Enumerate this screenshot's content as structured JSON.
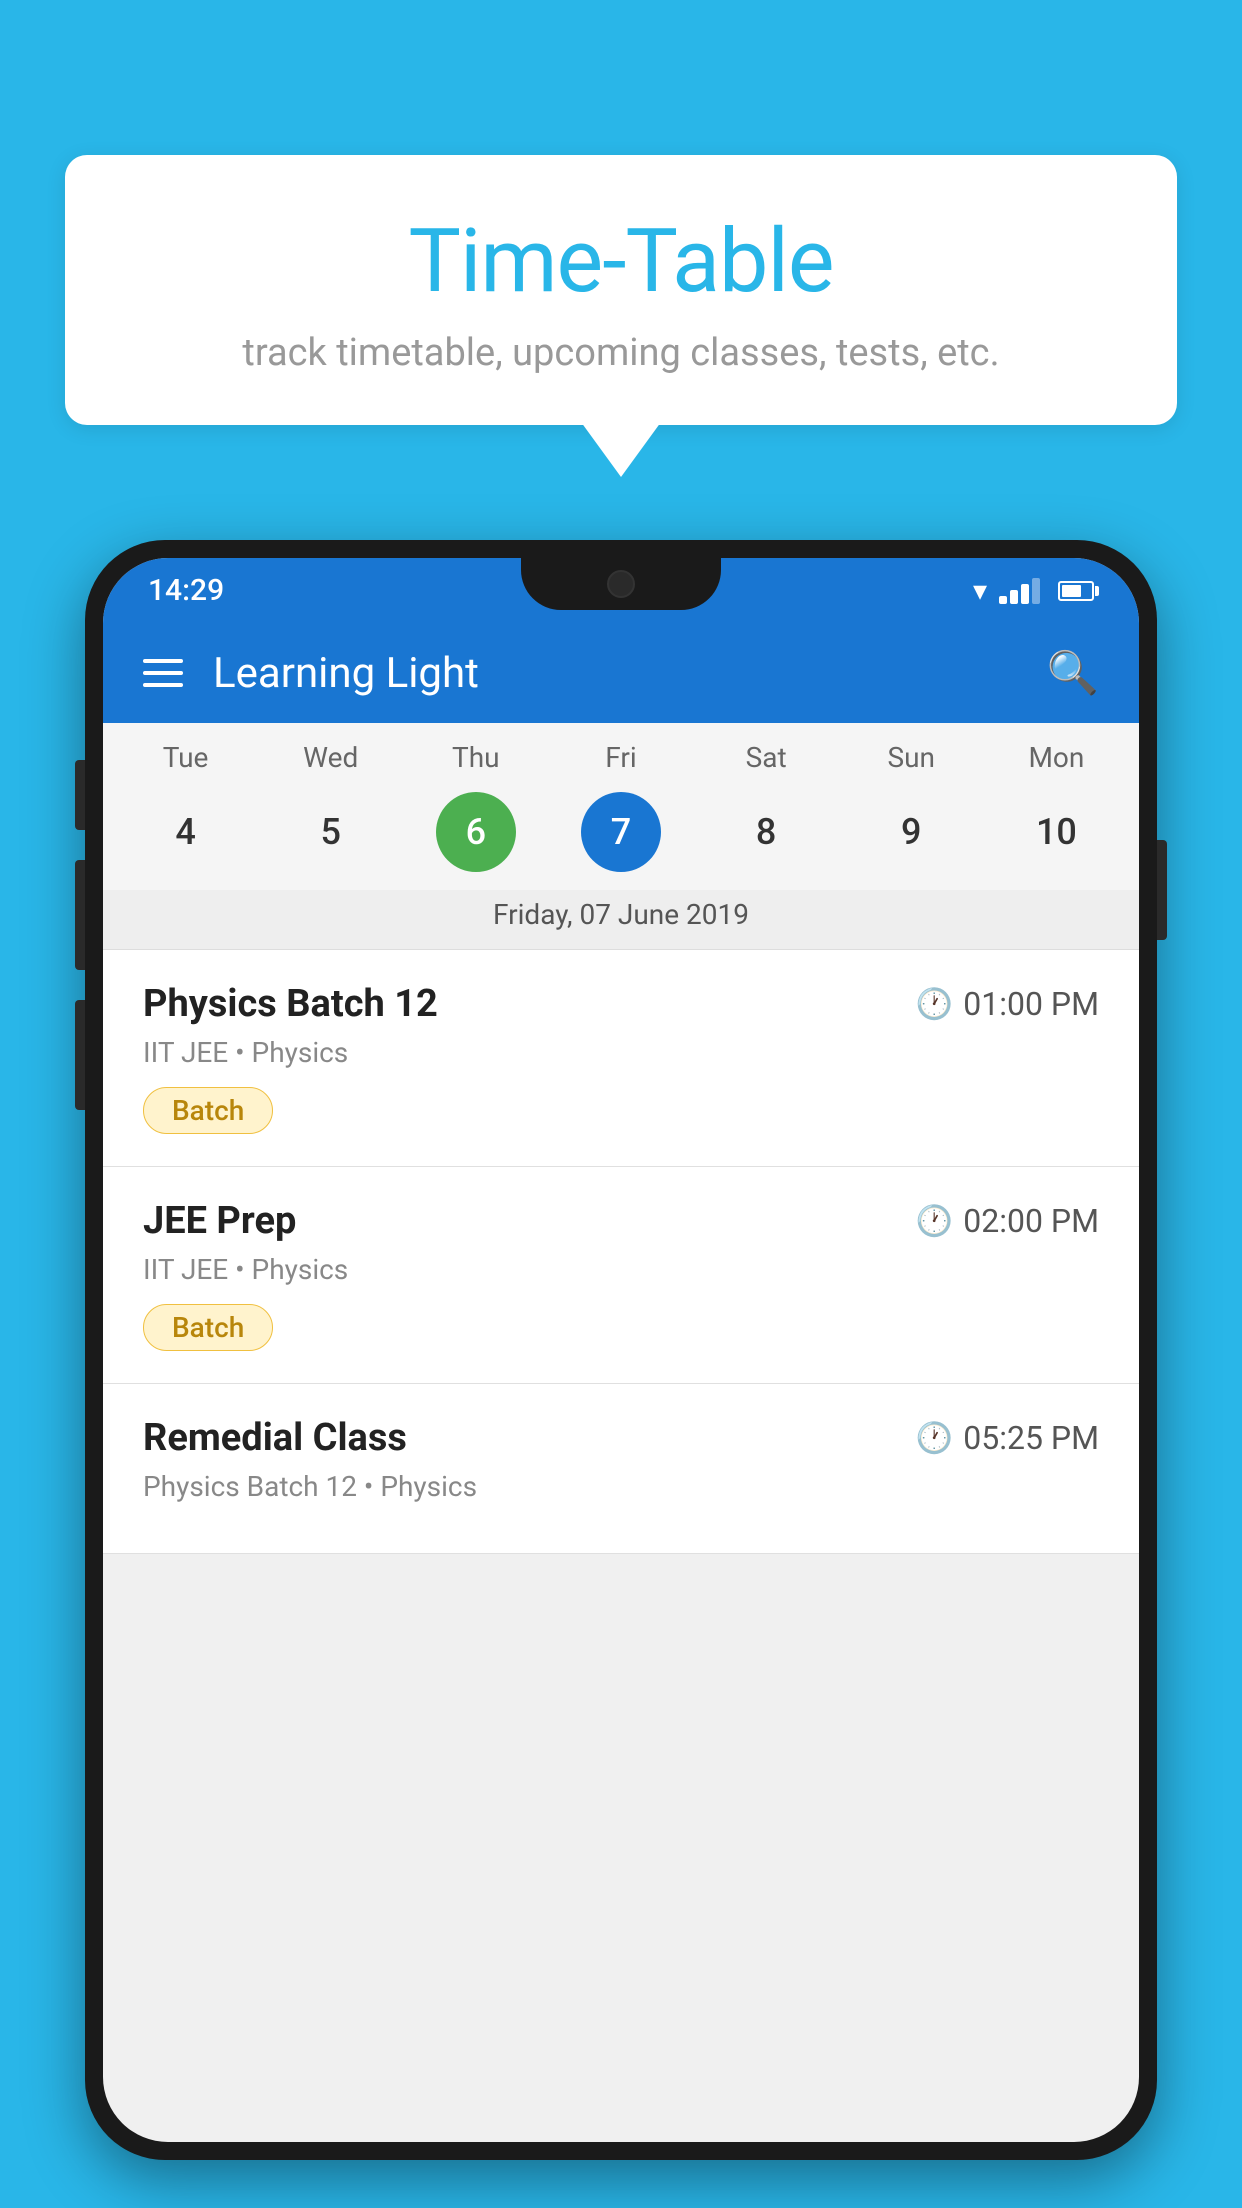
{
  "page": {
    "background_color": "#29b6e8"
  },
  "speech_bubble": {
    "title": "Time-Table",
    "subtitle": "track timetable, upcoming classes, tests, etc."
  },
  "phone": {
    "status_bar": {
      "time": "14:29"
    },
    "app_bar": {
      "title": "Learning Light"
    },
    "calendar": {
      "days": [
        {
          "label": "Tue",
          "number": "4"
        },
        {
          "label": "Wed",
          "number": "5"
        },
        {
          "label": "Thu",
          "number": "6",
          "state": "today"
        },
        {
          "label": "Fri",
          "number": "7",
          "state": "selected"
        },
        {
          "label": "Sat",
          "number": "8"
        },
        {
          "label": "Sun",
          "number": "9"
        },
        {
          "label": "Mon",
          "number": "10"
        }
      ],
      "selected_date_label": "Friday, 07 June 2019"
    },
    "classes": [
      {
        "name": "Physics Batch 12",
        "time": "01:00 PM",
        "meta": "IIT JEE • Physics",
        "badge": "Batch"
      },
      {
        "name": "JEE Prep",
        "time": "02:00 PM",
        "meta": "IIT JEE • Physics",
        "badge": "Batch"
      },
      {
        "name": "Remedial Class",
        "time": "05:25 PM",
        "meta": "Physics Batch 12 • Physics",
        "badge": null
      }
    ]
  }
}
